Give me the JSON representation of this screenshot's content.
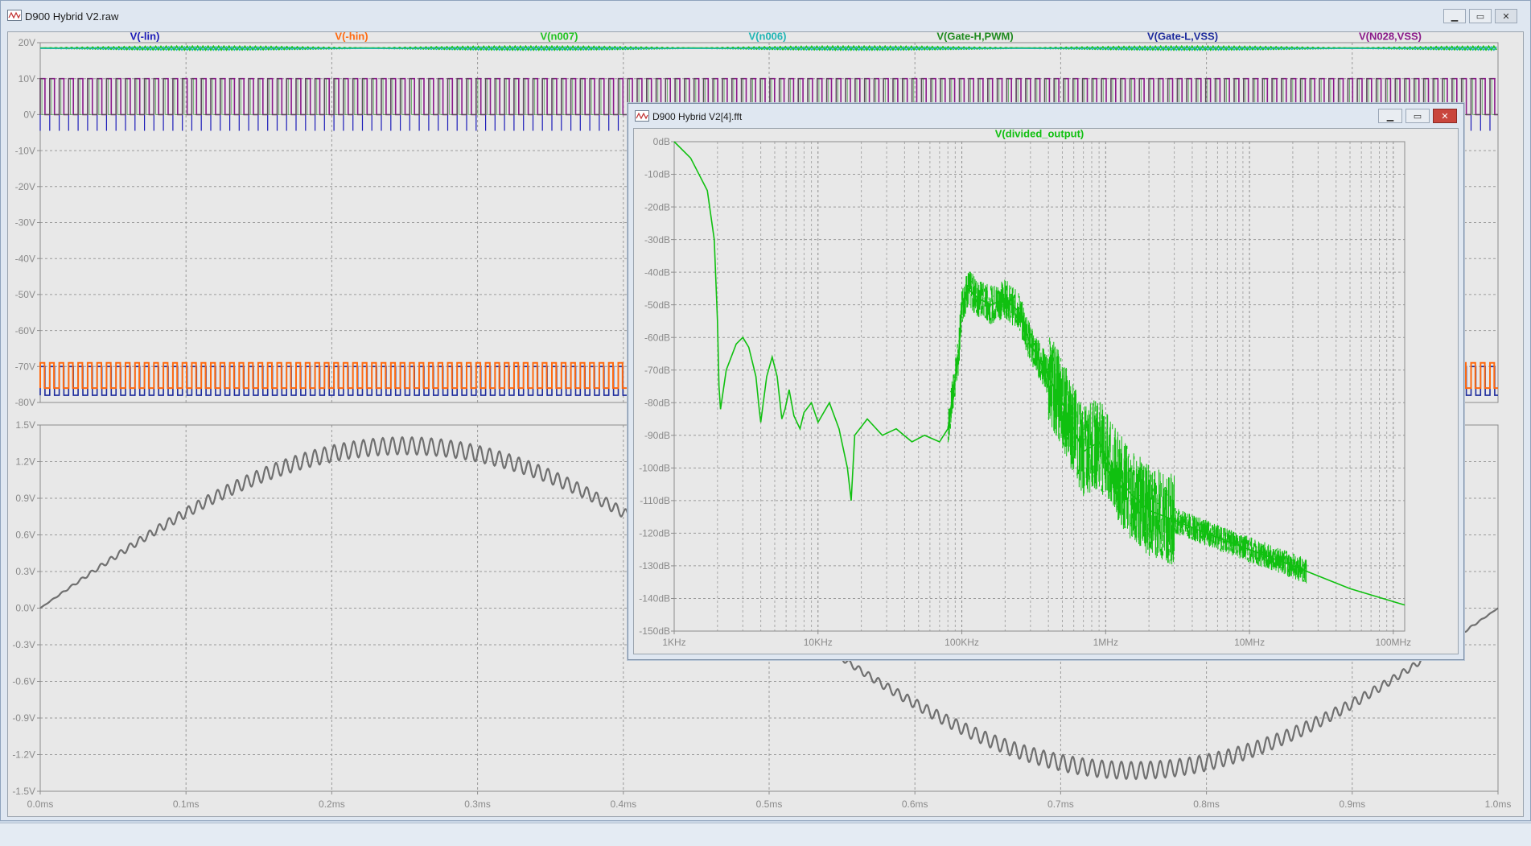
{
  "main_window": {
    "title": "D900 Hybrid V2.raw",
    "controls": {
      "minimize": "▁",
      "maximize": "▭",
      "close": "✕"
    }
  },
  "fft_window": {
    "title": "D900 Hybrid V2[4].fft",
    "controls": {
      "minimize": "▁",
      "maximize": "▭",
      "close": "✕"
    }
  },
  "colors": {
    "v_lin": "#1c1cb8",
    "v_hin": "#ff6a10",
    "v_n007": "#22c322",
    "v_n006": "#1fb5b5",
    "v_gate_h_pwm": "#1f8a1f",
    "v_gate_l_vss": "#1c2a9c",
    "v_n028_vss": "#8a1a8a",
    "lower_trace": "#707070",
    "fft_trace": "#10c010"
  },
  "chart_data": [
    {
      "type": "line",
      "panel": "upper",
      "legend": [
        "V(-lin)",
        "V(-hin)",
        "V(n007)",
        "V(n006)",
        "V(Gate-H,PWM)",
        "V(Gate-L,VSS)",
        "V(N028,VSS)"
      ],
      "y_ticks": [
        "20V",
        "10V",
        "0V",
        "-10V",
        "-20V",
        "-30V",
        "-40V",
        "-50V",
        "-60V",
        "-70V",
        "-80V"
      ],
      "ylim": [
        -80,
        20
      ],
      "xlim": [
        0,
        1.0
      ],
      "grid": true
    },
    {
      "type": "line",
      "panel": "lower",
      "y_ticks": [
        "1.5V",
        "1.2V",
        "0.9V",
        "0.6V",
        "0.3V",
        "0.0V",
        "-0.3V",
        "-0.6V",
        "-0.9V",
        "-1.2V",
        "-1.5V"
      ],
      "x_ticks": [
        "0.0ms",
        "0.1ms",
        "0.2ms",
        "0.3ms",
        "0.4ms",
        "0.5ms",
        "0.6ms",
        "0.7ms",
        "0.8ms",
        "0.9ms",
        "1.0ms"
      ],
      "ylim": [
        -1.5,
        1.5
      ],
      "xlim": [
        0,
        1.0
      ],
      "sine_amplitude": 1.33,
      "ripple_amplitude": 0.07,
      "grid": true
    },
    {
      "type": "line",
      "panel": "fft",
      "series": [
        {
          "name": "V(divided_output)",
          "x": [
            1000,
            1300,
            1700,
            1900,
            2000,
            2050,
            2100,
            2300,
            2700,
            3000,
            3300,
            3700,
            3900,
            4000,
            4400,
            4800,
            5200,
            5600,
            5900,
            6300,
            6800,
            7500,
            8000,
            9000,
            10000,
            12000,
            14000,
            16000,
            17000,
            18000,
            22000,
            28000,
            35000,
            45000,
            55000,
            70000,
            80000,
            85000,
            95000,
            100000,
            110000,
            130000,
            160000,
            200000,
            220000,
            250000,
            300000,
            400000,
            500000,
            700000,
            900000,
            1100000,
            1500000,
            2000000,
            3000000,
            5000000,
            10000000,
            20000000,
            50000000,
            120000000
          ],
          "y": [
            0,
            -5,
            -15,
            -30,
            -55,
            -75,
            -82,
            -70,
            -62,
            -60,
            -63,
            -72,
            -82,
            -86,
            -72,
            -66,
            -72,
            -85,
            -82,
            -76,
            -84,
            -88,
            -83,
            -80,
            -86,
            -80,
            -88,
            -100,
            -110,
            -90,
            -85,
            -90,
            -88,
            -92,
            -90,
            -92,
            -88,
            -80,
            -65,
            -50,
            -45,
            -48,
            -50,
            -48,
            -50,
            -52,
            -62,
            -72,
            -80,
            -95,
            -92,
            -100,
            -108,
            -113,
            -116,
            -120,
            -125,
            -130,
            -137,
            -142
          ]
        }
      ],
      "title": "V(divided_output)",
      "y_ticks": [
        "0dB",
        "-10dB",
        "-20dB",
        "-30dB",
        "-40dB",
        "-50dB",
        "-60dB",
        "-70dB",
        "-80dB",
        "-90dB",
        "-100dB",
        "-110dB",
        "-120dB",
        "-130dB",
        "-140dB",
        "-150dB"
      ],
      "x_ticks": [
        "1KHz",
        "10KHz",
        "100KHz",
        "1MHz",
        "10MHz",
        "100MHz"
      ],
      "xscale": "log",
      "xlim": [
        1000,
        120000000
      ],
      "ylim": [
        -150,
        0
      ],
      "grid": true
    }
  ]
}
